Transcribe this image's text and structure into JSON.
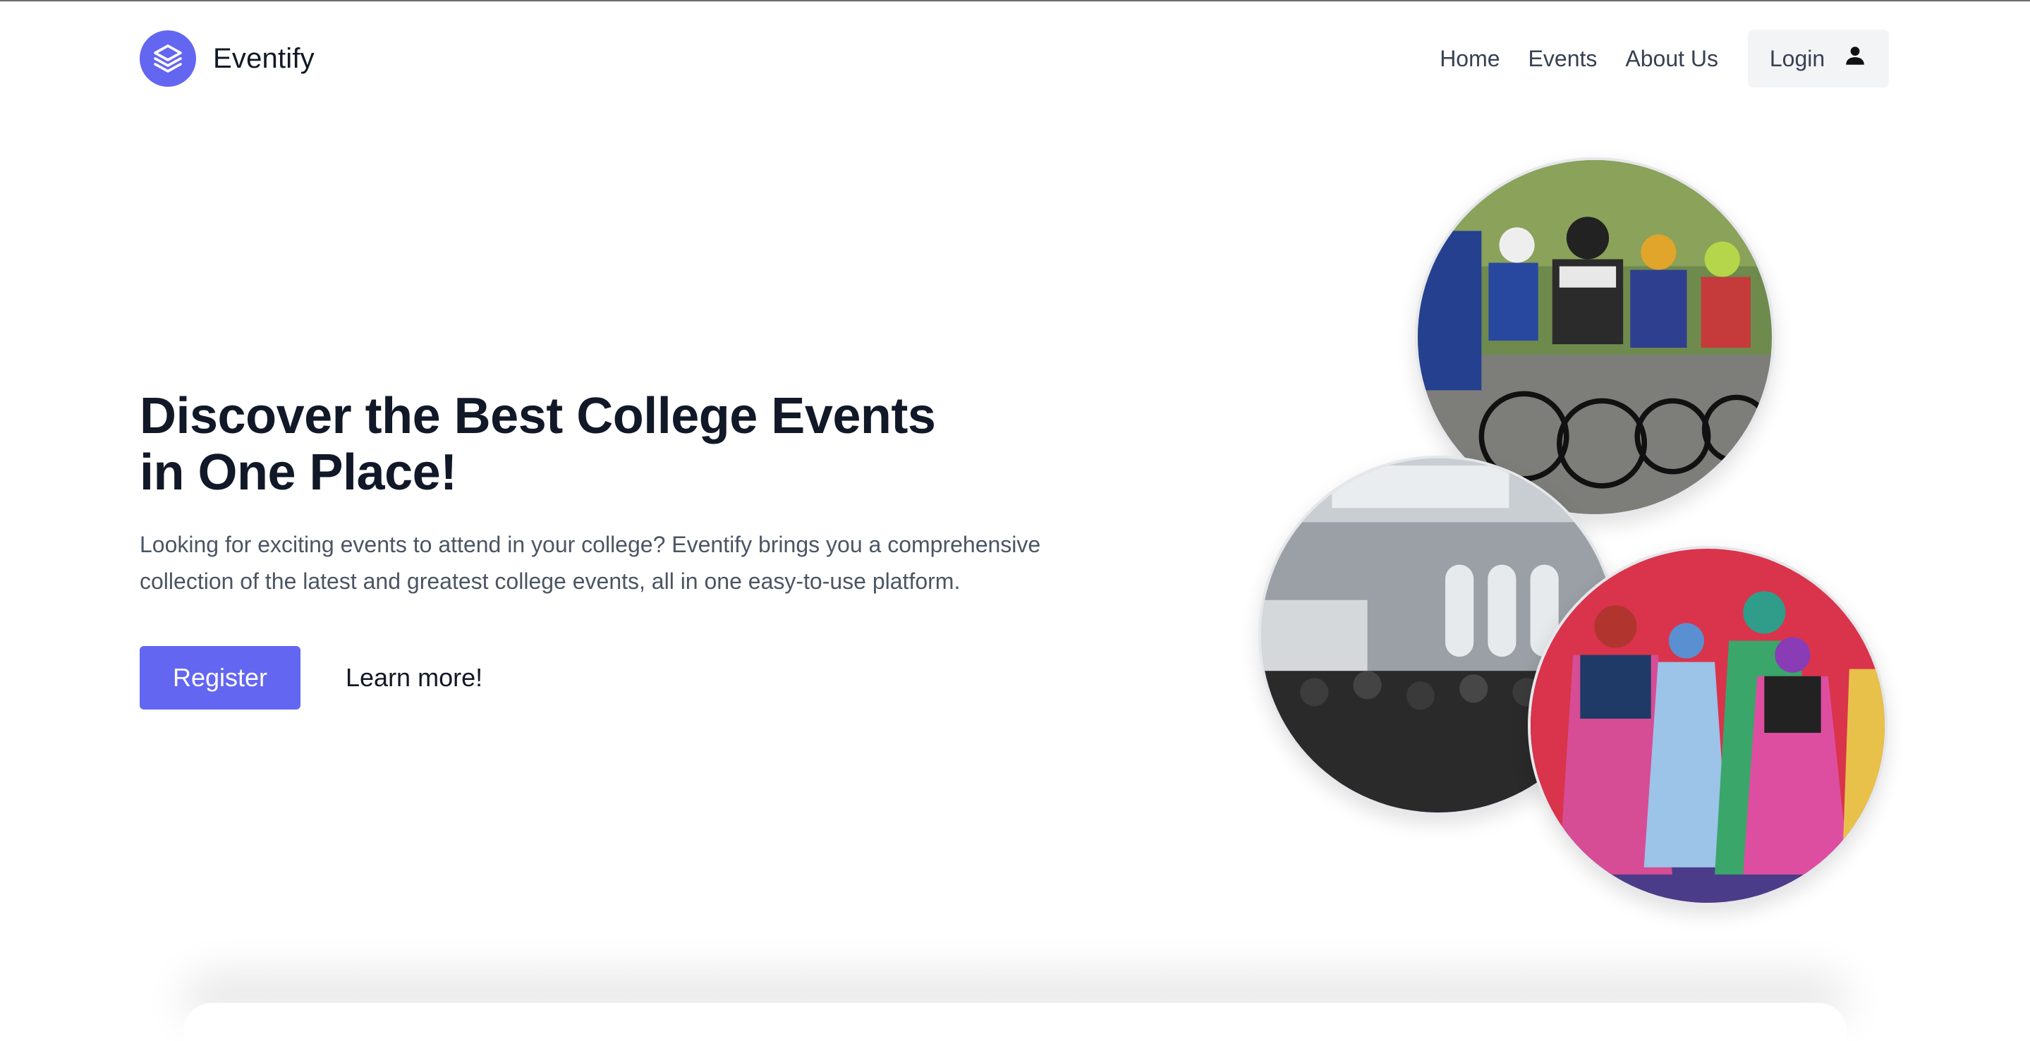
{
  "brand": {
    "name": "Eventify",
    "logo_icon": "layers-icon",
    "accent": "#6366f1"
  },
  "nav": {
    "items": [
      {
        "label": "Home"
      },
      {
        "label": "Events"
      },
      {
        "label": "About Us"
      }
    ],
    "login_label": "Login",
    "login_icon": "user-icon"
  },
  "hero": {
    "title_line1": "Discover the Best College Events",
    "title_line2": "in One Place!",
    "text": "Looking for exciting events to attend in your college? Eventify brings you a comprehensive collection of the latest and greatest college events, all in one easy-to-use platform.",
    "register_label": "Register",
    "learn_more_label": "Learn more!"
  },
  "images": [
    {
      "name": "cycling-race-photo"
    },
    {
      "name": "conference-hall-photo"
    },
    {
      "name": "folk-dance-photo"
    }
  ]
}
